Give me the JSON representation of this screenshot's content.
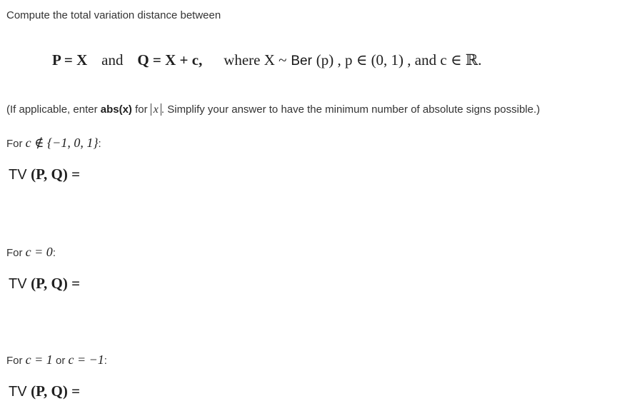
{
  "intro": "Compute the total variation distance between",
  "formula": {
    "p_def": "P = X",
    "and1": "and",
    "q_def": "Q = X + c,",
    "where": "where X ~",
    "ber": "Ber",
    "ber_arg": "(p) , p ∈ (0, 1) , and c ∈ ℝ."
  },
  "hint": {
    "pre": "(If applicable, enter ",
    "abs_bold": "abs(x)",
    "mid": " for ",
    "abs_sym": "x",
    "post": ". Simplify your answer to have the minimum number of absolute signs possible.)"
  },
  "cases": [
    {
      "label_pre": "For ",
      "label_math": "c ∉ {−1, 0, 1}",
      "label_post": ":"
    },
    {
      "label_pre": "For ",
      "label_math": "c = 0",
      "label_post": ":"
    },
    {
      "label_pre": "For ",
      "label_math": "c = 1",
      "label_mid": " or ",
      "label_math2": "c = −1",
      "label_post": ":"
    }
  ],
  "tv": {
    "prefix": "TV",
    "args": "(P, Q) ="
  }
}
